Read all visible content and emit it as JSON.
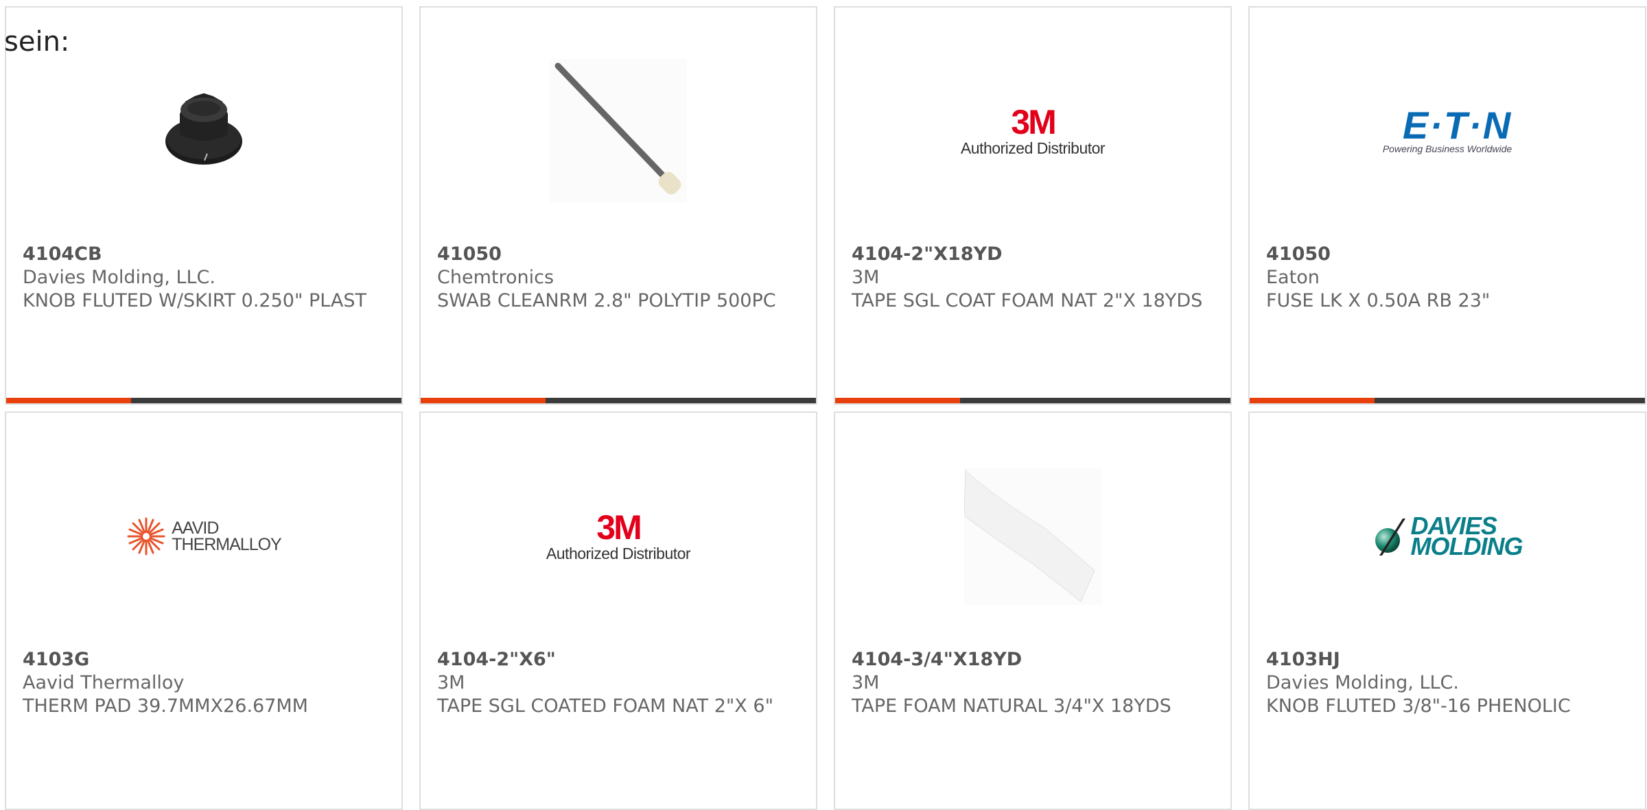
{
  "header": {
    "label": "sein:"
  },
  "colors": {
    "accent": "#e8400c",
    "bar": "#3b3b3b",
    "brand_3m": "#e2001a",
    "brand_eaton": "#0a6bb5",
    "brand_davies": "#0a7f8a"
  },
  "products": [
    {
      "part_number": "4104CB",
      "manufacturer": "Davies Molding, LLC.",
      "description": "KNOB FLUTED W/SKIRT 0.250\" PLAST",
      "image": "knob-image"
    },
    {
      "part_number": "41050",
      "manufacturer": "Chemtronics",
      "description": "SWAB CLEANRM 2.8\" POLYTIP 500PC",
      "image": "swab-image"
    },
    {
      "part_number": "4104-2\"X18YD",
      "manufacturer": "3M",
      "description": "TAPE SGL COAT FOAM NAT 2\"X 18YDS",
      "image": "3m-logo",
      "logo": {
        "mark": "3M",
        "sub": "Authorized Distributor"
      }
    },
    {
      "part_number": "41050",
      "manufacturer": "Eaton",
      "description": "FUSE LK X 0.50A RB 23\"",
      "image": "eaton-logo",
      "logo": {
        "mark": "E·T·N",
        "sub": "Powering Business Worldwide"
      }
    },
    {
      "part_number": "4103G",
      "manufacturer": "Aavid Thermalloy",
      "description": "THERM PAD 39.7MMX26.67MM",
      "image": "aavid-logo",
      "logo": {
        "line1": "AAVID",
        "line2": "THERMALLOY"
      }
    },
    {
      "part_number": "4104-2\"X6\"",
      "manufacturer": "3M",
      "description": "TAPE SGL COATED FOAM NAT 2\"X 6\"",
      "image": "3m-logo",
      "logo": {
        "mark": "3M",
        "sub": "Authorized Distributor"
      }
    },
    {
      "part_number": "4104-3/4\"X18YD",
      "manufacturer": "3M",
      "description": "TAPE FOAM NATURAL 3/4\"X 18YDS",
      "image": "foam-tape-image"
    },
    {
      "part_number": "4103HJ",
      "manufacturer": "Davies Molding, LLC.",
      "description": "KNOB FLUTED 3/8\"-16 PHENOLIC",
      "image": "davies-logo",
      "logo": {
        "line1": "DAVIES",
        "line2": "MOLDING"
      }
    }
  ]
}
